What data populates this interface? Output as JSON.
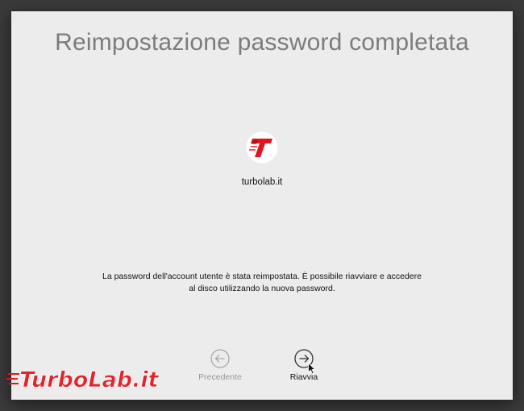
{
  "window": {
    "title": "Reimpostazione password completata"
  },
  "account": {
    "name": "turbolab.it",
    "avatar_icon": "turbolab-logo-icon"
  },
  "message": {
    "line1": "La password dell'account utente è stata reimpostata. È possibile riavviare e accedere",
    "line2": "al disco utilizzando la nuova password."
  },
  "navigation": {
    "back": {
      "label": "Precedente",
      "icon": "arrow-left-circle-icon",
      "enabled": false
    },
    "restart": {
      "label": "Riavvia",
      "icon": "arrow-right-circle-icon",
      "enabled": true
    }
  },
  "watermark": {
    "text": "TurboLab.it"
  },
  "colors": {
    "window_bg": "#ececec",
    "title": "#7c7c7c",
    "disabled": "#9a9a9a",
    "text": "#111111",
    "brand_red": "#e2141d",
    "desktop_bg": "#3a3a3a"
  }
}
